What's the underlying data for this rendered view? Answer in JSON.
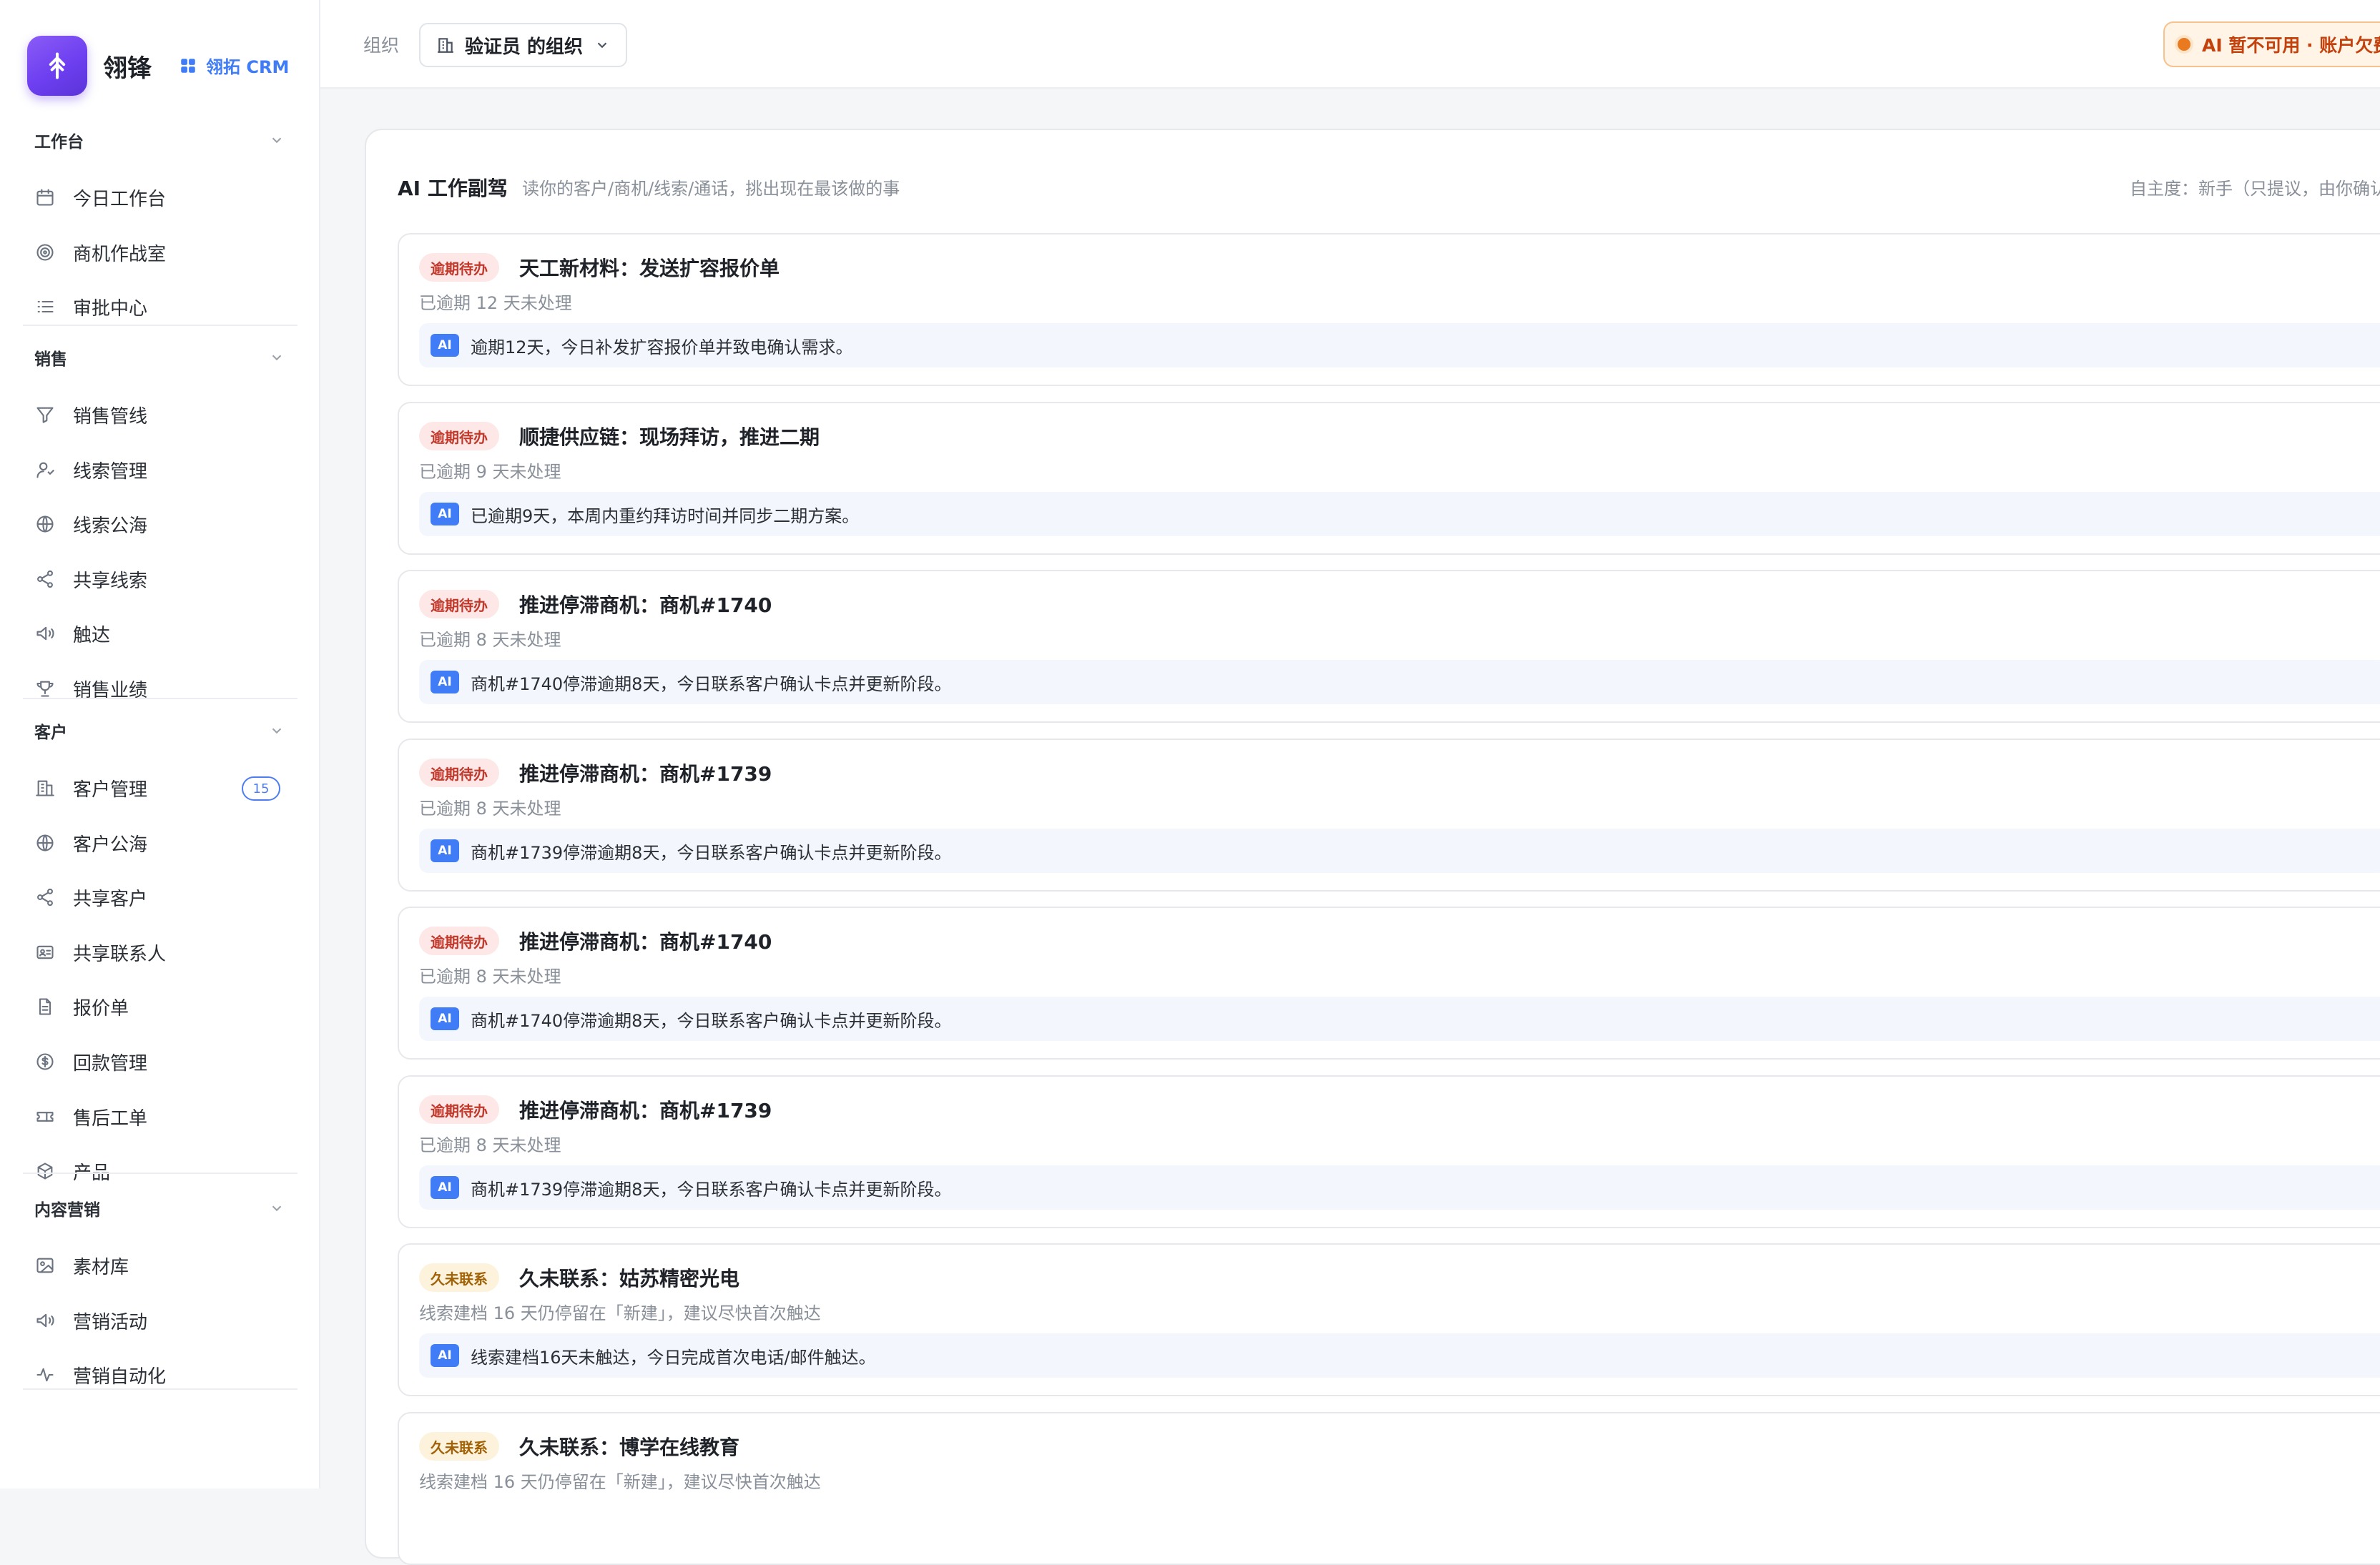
{
  "brand": {
    "name": "翎锋",
    "product": "翎拓 CRM"
  },
  "sidebar": {
    "groups": [
      {
        "title": "工作台",
        "items": [
          {
            "label": "今日工作台",
            "icon": "calendar-icon"
          },
          {
            "label": "商机作战室",
            "icon": "target-icon"
          },
          {
            "label": "审批中心",
            "icon": "list-icon"
          }
        ]
      },
      {
        "title": "销售",
        "items": [
          {
            "label": "销售管线",
            "icon": "funnel-icon"
          },
          {
            "label": "线索管理",
            "icon": "user-icon"
          },
          {
            "label": "线索公海",
            "icon": "globe-icon"
          },
          {
            "label": "共享线索",
            "icon": "share-icon"
          },
          {
            "label": "触达",
            "icon": "megaphone-icon"
          },
          {
            "label": "销售业绩",
            "icon": "trophy-icon"
          }
        ]
      },
      {
        "title": "客户",
        "items": [
          {
            "label": "客户管理",
            "icon": "building-icon",
            "badge": "15"
          },
          {
            "label": "客户公海",
            "icon": "globe-icon"
          },
          {
            "label": "共享客户",
            "icon": "share-icon"
          },
          {
            "label": "共享联系人",
            "icon": "contact-card-icon"
          },
          {
            "label": "报价单",
            "icon": "document-icon"
          },
          {
            "label": "回款管理",
            "icon": "coin-icon"
          },
          {
            "label": "售后工单",
            "icon": "ticket-icon"
          },
          {
            "label": "产品",
            "icon": "box-icon"
          }
        ]
      },
      {
        "title": "内容营销",
        "items": [
          {
            "label": "素材库",
            "icon": "image-icon"
          },
          {
            "label": "营销活动",
            "icon": "megaphone-icon"
          },
          {
            "label": "营销自动化",
            "icon": "activity-icon"
          }
        ]
      }
    ]
  },
  "topbar": {
    "org_label": "组织",
    "org_value": "验证员 的组织",
    "ai_alert": "AI 暂不可用 · 账户欠费"
  },
  "panel": {
    "title": "AI 工作副驾",
    "subtitle": "读你的客户/商机/线索/通话，挑出现在最该做的事",
    "autonomy": "自主度：新手（只提议，由你确认）",
    "cards": [
      {
        "tag": "逾期待办",
        "tag_type": "overdue",
        "title": "天工新材料：发送扩容报价单",
        "meta": "已逾期 12 天未处理",
        "ai_badge": "AI",
        "ai_text": "逾期12天，今日补发扩容报价单并致电确认需求。"
      },
      {
        "tag": "逾期待办",
        "tag_type": "overdue",
        "title": "顺捷供应链：现场拜访，推进二期",
        "meta": "已逾期 9 天未处理",
        "ai_badge": "AI",
        "ai_text": "已逾期9天，本周内重约拜访时间并同步二期方案。"
      },
      {
        "tag": "逾期待办",
        "tag_type": "overdue",
        "title": "推进停滞商机：商机#1740",
        "meta": "已逾期 8 天未处理",
        "ai_badge": "AI",
        "ai_text": "商机#1740停滞逾期8天，今日联系客户确认卡点并更新阶段。"
      },
      {
        "tag": "逾期待办",
        "tag_type": "overdue",
        "title": "推进停滞商机：商机#1739",
        "meta": "已逾期 8 天未处理",
        "ai_badge": "AI",
        "ai_text": "商机#1739停滞逾期8天，今日联系客户确认卡点并更新阶段。"
      },
      {
        "tag": "逾期待办",
        "tag_type": "overdue",
        "title": "推进停滞商机：商机#1740",
        "meta": "已逾期 8 天未处理",
        "ai_badge": "AI",
        "ai_text": "商机#1740停滞逾期8天，今日联系客户确认卡点并更新阶段。"
      },
      {
        "tag": "逾期待办",
        "tag_type": "overdue",
        "title": "推进停滞商机：商机#1739",
        "meta": "已逾期 8 天未处理",
        "ai_badge": "AI",
        "ai_text": "商机#1739停滞逾期8天，今日联系客户确认卡点并更新阶段。"
      },
      {
        "tag": "久未联系",
        "tag_type": "cold",
        "title": "久未联系：姑苏精密光电",
        "meta": "线索建档 16 天仍停留在「新建」，建议尽快首次触达",
        "ai_badge": "AI",
        "ai_text": "线索建档16天未触达，今日完成首次电话/邮件触达。"
      },
      {
        "tag": "久未联系",
        "tag_type": "cold",
        "title": "久未联系：博学在线教育",
        "meta": "线索建档 16 天仍停留在「新建」，建议尽快首次触达",
        "ai_badge": "AI",
        "ai_text": ""
      }
    ]
  },
  "colors": {
    "accent": "#3f7cf5",
    "brand": "#6d3ff0",
    "warning": "#ea7a1f",
    "danger": "#c0392b"
  }
}
